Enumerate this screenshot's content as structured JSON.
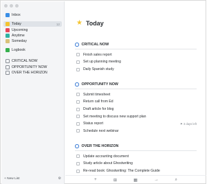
{
  "sidebar": {
    "items": [
      {
        "label": "Inbox",
        "icon": "inbox-icon"
      },
      {
        "label": "Today",
        "icon": "star-icon",
        "count": "12"
      },
      {
        "label": "Upcoming",
        "icon": "calendar-icon"
      },
      {
        "label": "Anytime",
        "icon": "layers-icon"
      },
      {
        "label": "Someday",
        "icon": "box-icon"
      },
      {
        "label": "Logbook",
        "icon": "checkbook-icon"
      }
    ],
    "projects": [
      {
        "label": "CRITICAL NOW"
      },
      {
        "label": "OPPORTUNITY NOW"
      },
      {
        "label": "OVER THE HORIZON"
      }
    ],
    "new_list": "+ New List"
  },
  "main": {
    "title": "Today",
    "sections": [
      {
        "title": "CRITICAL NOW",
        "tasks": [
          {
            "label": "Finish sales report"
          },
          {
            "label": "Set up planning meeting"
          },
          {
            "label": "Daily Spanish study"
          }
        ]
      },
      {
        "title": "OPPORTUNITY NOW",
        "tasks": [
          {
            "label": "Submit timesheet"
          },
          {
            "label": "Return call from Ed"
          },
          {
            "label": "Draft article for blog"
          },
          {
            "label": "Set meeting to discuss new support plan"
          },
          {
            "label": "Status report",
            "meta": "3 days left"
          },
          {
            "label": "Schedule next webinar"
          }
        ]
      },
      {
        "title": "OVER THE HORIZON",
        "tasks": [
          {
            "label": "Update accounting document"
          },
          {
            "label": "Study article about Ghostwriting"
          },
          {
            "label": "Re-read book: Ghostwriting: The Complete Guide"
          }
        ]
      }
    ]
  },
  "colors": {
    "accent": "#3a7bd5",
    "today_star": "#f4c430"
  }
}
